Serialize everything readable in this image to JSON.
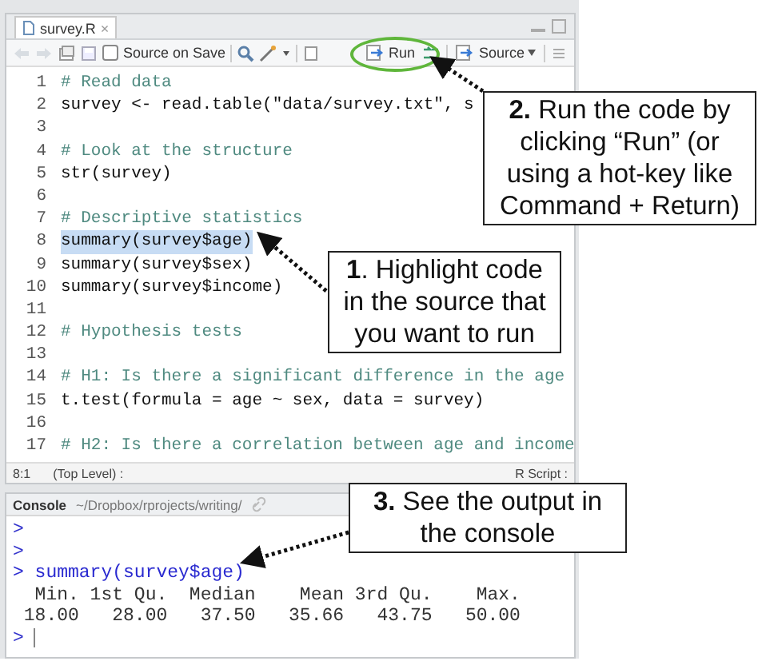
{
  "editor": {
    "tab": {
      "label": "survey.R",
      "close": "×"
    },
    "toolbar": {
      "source_on_save": {
        "label": "Source on Save",
        "checked": false
      },
      "run": "Run",
      "source": "Source"
    },
    "lines": [
      {
        "number": "1",
        "text": "# Read data",
        "kind": "comment",
        "selected": false
      },
      {
        "number": "2",
        "text": "survey <- read.table(\"data/survey.txt\", s",
        "kind": "code",
        "selected": false
      },
      {
        "number": "3",
        "kind": "blank",
        "selected": false
      },
      {
        "number": "4",
        "text": "# Look at the structure",
        "kind": "comment",
        "selected": false
      },
      {
        "number": "5",
        "text": "str(survey)",
        "kind": "code",
        "selected": false
      },
      {
        "number": "6",
        "kind": "blank",
        "selected": false
      },
      {
        "number": "7",
        "text": "# Descriptive statistics",
        "kind": "comment",
        "selected": false
      },
      {
        "number": "8",
        "text": "summary(survey$age)",
        "kind": "code",
        "selected": true
      },
      {
        "number": "9",
        "text": "summary(survey$sex)",
        "kind": "code",
        "selected": false
      },
      {
        "number": "10",
        "text": "summary(survey$income)",
        "kind": "code",
        "selected": false
      },
      {
        "number": "11",
        "kind": "blank",
        "selected": false
      },
      {
        "number": "12",
        "text": "# Hypothesis tests",
        "kind": "comment",
        "selected": false
      },
      {
        "number": "13",
        "kind": "blank",
        "selected": false
      },
      {
        "number": "14",
        "text": "# H1: Is there a significant difference in the age",
        "kind": "comment",
        "selected": false
      },
      {
        "number": "15",
        "text": "t.test(formula = age ~ sex, data = survey)",
        "kind": "code",
        "selected": false
      },
      {
        "number": "16",
        "kind": "blank",
        "selected": false
      },
      {
        "number": "17",
        "text": "# H2: Is there a correlation between age and income",
        "kind": "comment",
        "selected": false
      }
    ],
    "status": {
      "position": "8:1",
      "scope": "(Top Level) :",
      "file_type": "R Script :"
    }
  },
  "console": {
    "title": "Console",
    "path": "~/Dropbox/rprojects/writing/",
    "lines": [
      {
        "kind": "prompt",
        "text": ">"
      },
      {
        "kind": "prompt",
        "text": ">"
      },
      {
        "kind": "command",
        "text": "> summary(survey$age)"
      },
      {
        "kind": "output",
        "text": "  Min. 1st Qu.  Median    Mean 3rd Qu.    Max. "
      },
      {
        "kind": "output",
        "text": " 18.00   28.00   37.50   35.66   43.75   50.00 "
      },
      {
        "kind": "cursor",
        "text": ">"
      }
    ]
  },
  "callouts": [
    {
      "kind": "source",
      "text": "**1**. Highlight code in the source that you want to run"
    },
    {
      "kind": "run",
      "text": "**2.** Run the code by clicking “Run” (or using a hot-key like Command + Return)"
    },
    {
      "kind": "console",
      "text": "**3.** See the output in the console"
    }
  ]
}
